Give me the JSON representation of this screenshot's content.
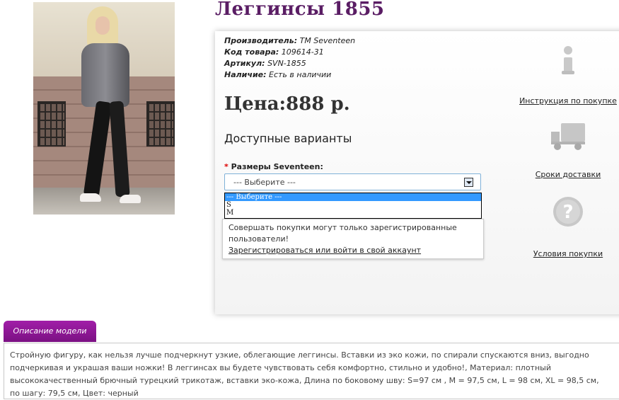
{
  "product": {
    "title": "Леггинсы 1855",
    "specs": [
      {
        "label": "Производитель:",
        "value": "TM Seventeen"
      },
      {
        "label": "Код товара:",
        "value": "109614-31"
      },
      {
        "label": "Артикул:",
        "value": "SVN-1855"
      },
      {
        "label": "Наличие:",
        "value": "Есть в наличии"
      }
    ],
    "price": "Цена:888 р.",
    "variants_heading": "Доступные варианты"
  },
  "size_select": {
    "required_mark": "*",
    "label": "Размеры Seventeen:",
    "selected": "--- Выберите ---",
    "options": [
      "--- Выберите ---",
      "S",
      "M"
    ]
  },
  "notice": {
    "message": "Совершать покупки могут только зарегистрированные пользователи!",
    "link": "Зарегистрироваться или войти в свой аккаунт"
  },
  "side_links": [
    {
      "icon": "info-icon",
      "label": "Инструкция по покупке"
    },
    {
      "icon": "truck-icon",
      "label": "Сроки доставки"
    },
    {
      "icon": "question-icon",
      "label": "Условия покупки"
    }
  ],
  "description": {
    "tab_label": "Описание модели",
    "text": "Стройную фигуру, как нельзя лучше подчеркнут узкие, облегающие леггинсы. Вставки из эко кожи, по спирали спускаются вниз, выгодно подчеркивая и украшая ваши ножки! В леггинсах вы будете чувствовать себя комфортно, стильно и удобно!, Материал: плотный высококачественный брючный турецкий трикотаж, вставки эко-кожа, Длина по боковому шву: S=97 см , M = 97,5 см, L = 98 см, XL = 98,5 см, по шагу: 79,5 см, Цвет: черный"
  },
  "colors": {
    "title": "#5a1d64",
    "tab": "#8e1796",
    "select_border": "#7fb1d8",
    "option_highlight": "#3399ff"
  }
}
